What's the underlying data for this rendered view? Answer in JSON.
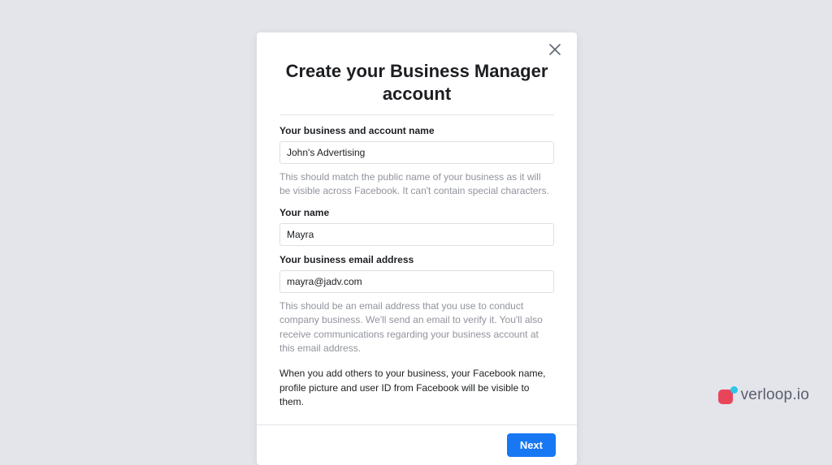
{
  "modal": {
    "title": "Create your Business Manager account",
    "fields": {
      "business_name": {
        "label": "Your business and account name",
        "value": "John's Advertising",
        "help": "This should match the public name of your business as it will be visible across Facebook. It can't contain special characters."
      },
      "your_name": {
        "label": "Your name",
        "value": "Mayra"
      },
      "email": {
        "label": "Your business email address",
        "value": "mayra@jadv.com",
        "help": "This should be an email address that you use to conduct company business. We'll send an email to verify it. You'll also receive communications regarding your business account at this email address."
      }
    },
    "info": "When you add others to your business, your Facebook name, profile picture and user ID from Facebook will be visible to them.",
    "next_label": "Next"
  },
  "brand": {
    "name": "verloop.io"
  }
}
